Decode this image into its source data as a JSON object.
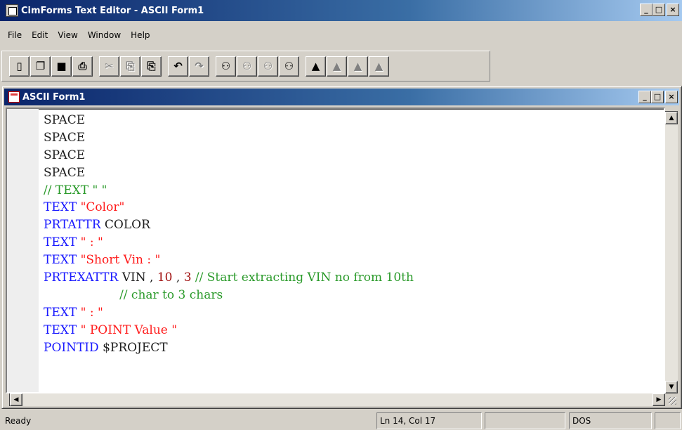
{
  "window": {
    "title": "CimForms Text Editor - ASCII Form1",
    "minimize": "_",
    "maximize": "□",
    "close": "×"
  },
  "menu": [
    "File",
    "Edit",
    "View",
    "Window",
    "Help"
  ],
  "toolbar": {
    "icons": [
      {
        "name": "new-icon",
        "glyph": "▯",
        "disabled": false
      },
      {
        "name": "open-icon",
        "glyph": "❐",
        "disabled": false
      },
      {
        "name": "save-icon",
        "glyph": "■",
        "disabled": false
      },
      {
        "name": "print-icon",
        "glyph": "⎙",
        "disabled": false
      },
      {
        "name": "cut-icon",
        "glyph": "✂",
        "disabled": true
      },
      {
        "name": "copy-icon",
        "glyph": "⎘",
        "disabled": true
      },
      {
        "name": "paste-icon",
        "glyph": "⎘",
        "disabled": false
      },
      {
        "name": "undo-icon",
        "glyph": "↶",
        "disabled": false
      },
      {
        "name": "redo-icon",
        "glyph": "↷",
        "disabled": true
      },
      {
        "name": "find-icon",
        "glyph": "⚇",
        "disabled": false
      },
      {
        "name": "find-next-icon",
        "glyph": "⚇",
        "disabled": true
      },
      {
        "name": "find-previous-icon",
        "glyph": "⚇",
        "disabled": true
      },
      {
        "name": "replace-icon",
        "glyph": "⚇",
        "disabled": false
      },
      {
        "name": "toggle-bookmark-icon",
        "glyph": "▲",
        "disabled": false
      },
      {
        "name": "next-bookmark-icon",
        "glyph": "▲",
        "disabled": true
      },
      {
        "name": "previous-bookmark-icon",
        "glyph": "▲",
        "disabled": true
      },
      {
        "name": "clear-bookmarks-icon",
        "glyph": "▲",
        "disabled": true
      }
    ],
    "separators_after": [
      3,
      6,
      8,
      12
    ]
  },
  "document": {
    "title": "ASCII Form1",
    "lines": [
      [
        {
          "t": "SPACE",
          "c": "plain"
        }
      ],
      [
        {
          "t": "SPACE",
          "c": "plain"
        }
      ],
      [
        {
          "t": "SPACE",
          "c": "plain"
        }
      ],
      [
        {
          "t": "SPACE",
          "c": "plain"
        }
      ],
      [
        {
          "t": "// TEXT \" \"",
          "c": "cmt"
        }
      ],
      [
        {
          "t": "TEXT ",
          "c": "kw"
        },
        {
          "t": "\"Color\"",
          "c": "str"
        }
      ],
      [
        {
          "t": "PRTATTR ",
          "c": "kw"
        },
        {
          "t": "COLOR",
          "c": "plain"
        }
      ],
      [
        {
          "t": "TEXT ",
          "c": "kw"
        },
        {
          "t": "\" : \"",
          "c": "str"
        }
      ],
      [
        {
          "t": "TEXT ",
          "c": "kw"
        },
        {
          "t": "\"Short Vin : \"",
          "c": "str"
        }
      ],
      [
        {
          "t": "PRTEXATTR ",
          "c": "kw"
        },
        {
          "t": "VIN , ",
          "c": "plain"
        },
        {
          "t": "10",
          "c": "num"
        },
        {
          "t": " , ",
          "c": "plain"
        },
        {
          "t": "3",
          "c": "num"
        },
        {
          "t": " // Start extracting VIN no from 10th",
          "c": "cmt"
        }
      ],
      [
        {
          "t": "                    // char to 3 chars",
          "c": "cmt"
        }
      ],
      [
        {
          "t": "TEXT ",
          "c": "kw"
        },
        {
          "t": "\" : \"",
          "c": "str"
        }
      ],
      [
        {
          "t": "TEXT ",
          "c": "kw"
        },
        {
          "t": "\" POINT Value \"",
          "c": "str"
        }
      ],
      [
        {
          "t": "POINTID ",
          "c": "kw"
        },
        {
          "t": "$PROJECT",
          "c": "plain"
        }
      ]
    ]
  },
  "statusbar": {
    "message": "Ready",
    "position": "Ln 14, Col 17",
    "empty_pane": "",
    "line_endings": "DOS"
  }
}
